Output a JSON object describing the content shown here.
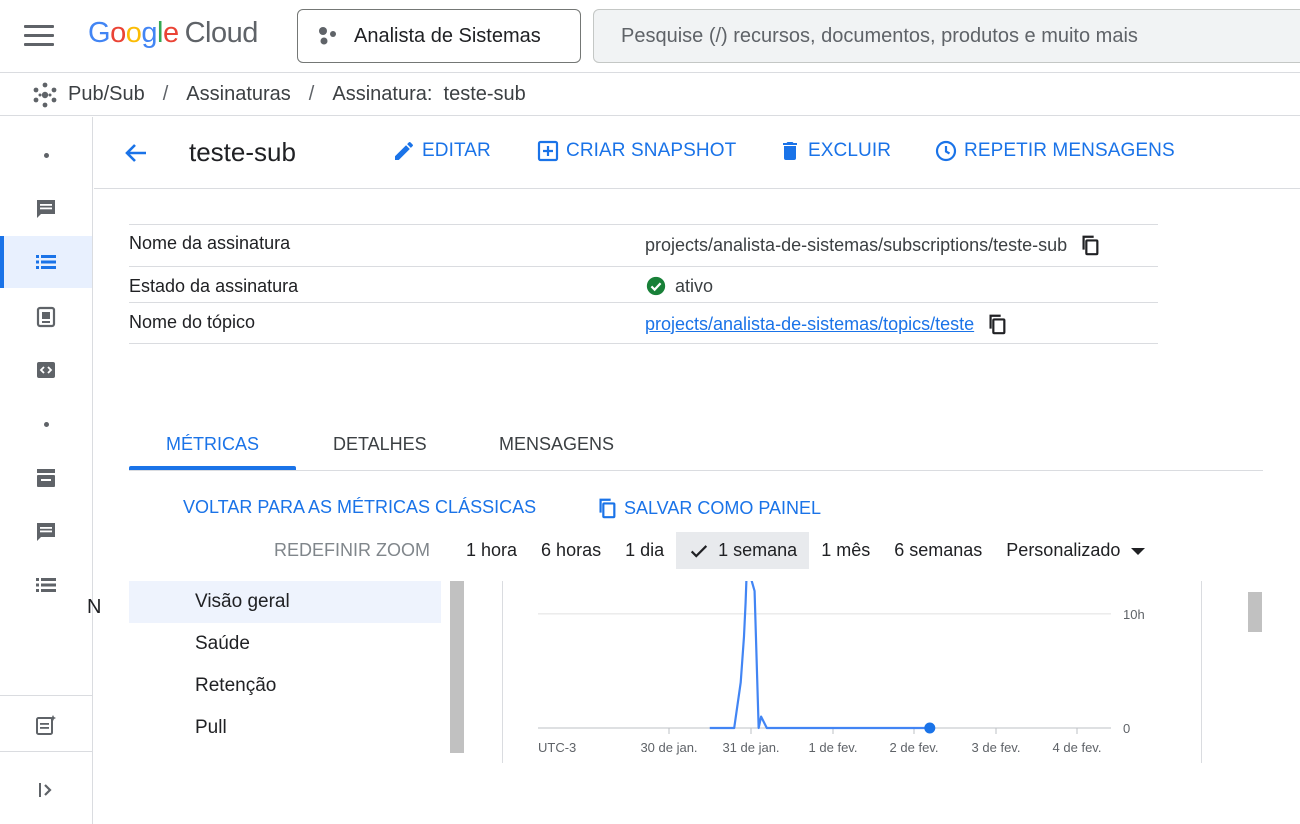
{
  "topbar": {
    "logo_letters": [
      "G",
      "o",
      "o",
      "g",
      "l",
      "e"
    ],
    "logo_cloud": "Cloud",
    "project": "Analista de Sistemas",
    "search_placeholder": "Pesquise (/) recursos, documentos, produtos e muito mais"
  },
  "breadcrumb": [
    "Pub/Sub",
    "Assinaturas",
    "Assinatura:  teste-sub"
  ],
  "rail": {
    "cut_label": "N"
  },
  "header": {
    "title": "teste-sub",
    "edit": "EDITAR",
    "snapshot": "CRIAR SNAPSHOT",
    "delete": "EXCLUIR",
    "replay": "REPETIR MENSAGENS"
  },
  "props": [
    {
      "label": "Nome da assinatura",
      "value": "projects/analista-de-sistemas/subscriptions/teste-sub"
    },
    {
      "label": "Estado da assinatura",
      "value": "ativo"
    },
    {
      "label": "Nome do tópico",
      "value": "projects/analista-de-sistemas/topics/teste"
    }
  ],
  "tabs": [
    "MÉTRICAS",
    "DETALHES",
    "MENSAGENS"
  ],
  "metrics_toolbar": {
    "classic": "VOLTAR PARA AS MÉTRICAS CLÁSSICAS",
    "save": "SALVAR COMO PAINEL",
    "reset_zoom": "REDEFINIR ZOOM",
    "ranges": [
      "1 hora",
      "6 horas",
      "1 dia",
      "1 semana",
      "1 mês",
      "6 semanas",
      "Personalizado"
    ],
    "selected_range": "1 semana"
  },
  "metric_nav": [
    "Visão geral",
    "Saúde",
    "Retenção",
    "Pull"
  ],
  "colors": {
    "accent": "#1a73e8",
    "success": "#188038",
    "line": "#4285f4"
  },
  "chart_data": {
    "type": "line",
    "x_labels": [
      "UTC-3",
      "30 de jan.",
      "31 de jan.",
      "1 de fev.",
      "2 de fev.",
      "3 de fev.",
      "4 de fev."
    ],
    "y_ticks": [
      "10h",
      "0"
    ],
    "ylim_hours": [
      0,
      12
    ],
    "series": [
      {
        "x": [
          1.5,
          1.55,
          1.62,
          1.7,
          1.8,
          1.88,
          1.92,
          1.94,
          1.95,
          1.97,
          2.05,
          2.1,
          2.13,
          2.2,
          2.3,
          2.5,
          3.0,
          3.5,
          4.0,
          4.2
        ],
        "values": [
          0,
          0,
          0,
          0,
          0,
          4,
          8,
          11,
          13,
          14,
          12,
          0,
          1,
          0,
          0,
          0,
          0,
          0,
          0,
          0
        ]
      }
    ]
  }
}
